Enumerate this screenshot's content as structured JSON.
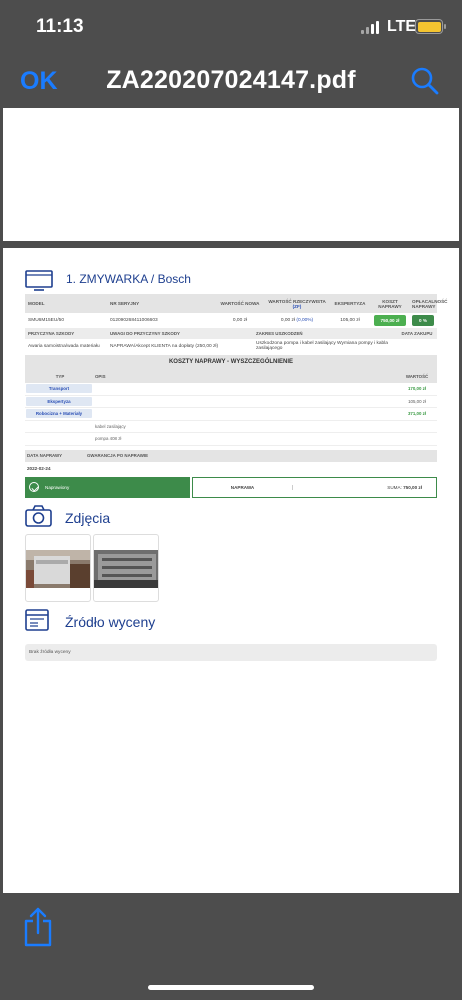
{
  "status": {
    "time": "11:13",
    "network": "LTE"
  },
  "nav": {
    "ok_label": "OK",
    "title": "ZA220207024147.pdf"
  },
  "device": {
    "title": "1. ZMYWARKA / Bosch",
    "headers": [
      "MODEL",
      "NR SERYJNY",
      "WARTOŚĆ NOWA",
      "WARTOŚĆ RZECZYWISTA",
      "(ZF)",
      "EKSPERTYZA",
      "KOSZT NAPRAWY",
      "OPŁACALNOŚĆ NAPRAWY"
    ],
    "model": "SMU6M15EU/50",
    "serial": "012090268411006603",
    "value_new": "0,00 zł",
    "value_real": "0,00 zł",
    "value_real_pct": "(0,00%)",
    "expertise": "105,00 zł",
    "repair_cost": "750,00 zł",
    "profitability": "0 %"
  },
  "damage": {
    "headers": [
      "PRZYCZYNA SZKODY",
      "UWAGI DO PRZYCZYNY SZKODY",
      "ZAKRES USZKODZEŃ",
      "DATA ZAKUPU"
    ],
    "cause": "Awaria samoistna/wada materiału",
    "notes": "NAPRAWA/Akcept KLIENTA na dopłaty (250,00 zł)",
    "scope": "Uszkodzona pompa i kabel zasilający Wymiana pompy i kabla zasilającego",
    "purchase_date": ""
  },
  "costs": {
    "title": "KOSZTY NAPRAWY - WYSZCZEGÓLNIENIE",
    "headers": {
      "type": "TYP",
      "desc": "OPIS",
      "value": "WARTOŚĆ"
    },
    "rows": [
      {
        "type": "Transport",
        "desc": "",
        "value": "170,00 zł"
      },
      {
        "type": "Ekspertyza",
        "desc": "",
        "value": "105,00 zł"
      },
      {
        "type": "Robocizna + Materiały",
        "desc": "",
        "value": "371,00 zł"
      },
      {
        "type": "",
        "desc": "kabel zasilający",
        "value": ""
      },
      {
        "type": "",
        "desc": "pompa 408 zł",
        "value": ""
      }
    ]
  },
  "repair": {
    "date_label": "DATA NAPRAWY",
    "warranty_label": "GWARANCJA PO NAPRAWIE",
    "date": "2022-02-24",
    "warranty": "",
    "status_label": "Naprawiony",
    "repair_label": "NAPRAWA",
    "sum_label": "SUMA:",
    "sum_value": "750,00 zł"
  },
  "photos": {
    "title": "Zdjęcia"
  },
  "source": {
    "title": "Źródło wyceny",
    "text": "Brak źródła wyceny"
  },
  "colors": {
    "accent": "#1a7cff",
    "heading": "#1e3f8f",
    "green": "#3d8b4a"
  }
}
